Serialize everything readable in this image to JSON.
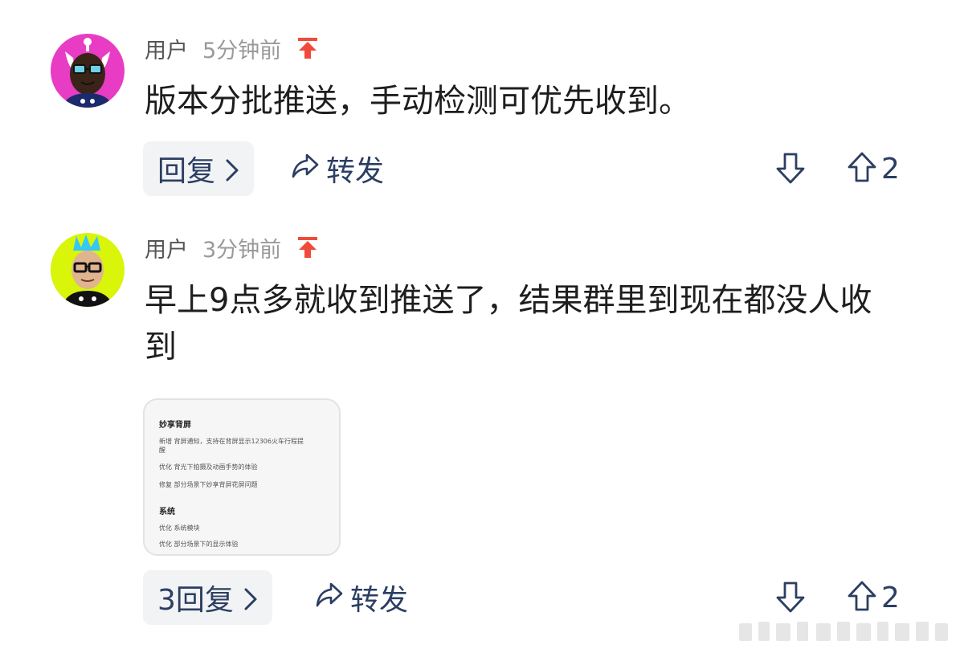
{
  "comments": [
    {
      "username": "用户",
      "time": "5分钟前",
      "text": "版本分批推送，手动检测可优先收到。",
      "reply_label": "回复",
      "forward_label": "转发",
      "up_count": "2"
    },
    {
      "username": "用户",
      "time": "3分钟前",
      "text": "早上9点多就收到推送了，结果群里到现在都没人收到",
      "image": {
        "title": "妙享背屏",
        "lines": [
          "新增 背屏通知，支持在背屏显示12306火车行程提",
          "醒",
          "优化 背光下拍摄及动画手势的体验",
          "修复 部分场景下妙享背屏花屏问题"
        ],
        "section": "系统",
        "section_lines": [
          "优化 系统模块",
          "优化 部分场景下的显示体验"
        ]
      },
      "reply_label": "3回复",
      "forward_label": "转发",
      "up_count": "2"
    }
  ],
  "colors": {
    "accent": "#2c3e62",
    "pin": "#f04b3a",
    "avatar1_bg": "#e83cc4",
    "avatar2_bg": "#d8f50a"
  },
  "icons": [
    "pin-top-icon",
    "chevron-right-icon",
    "share-arrow-icon",
    "thumb-down-arrow-icon",
    "thumb-up-arrow-icon"
  ]
}
